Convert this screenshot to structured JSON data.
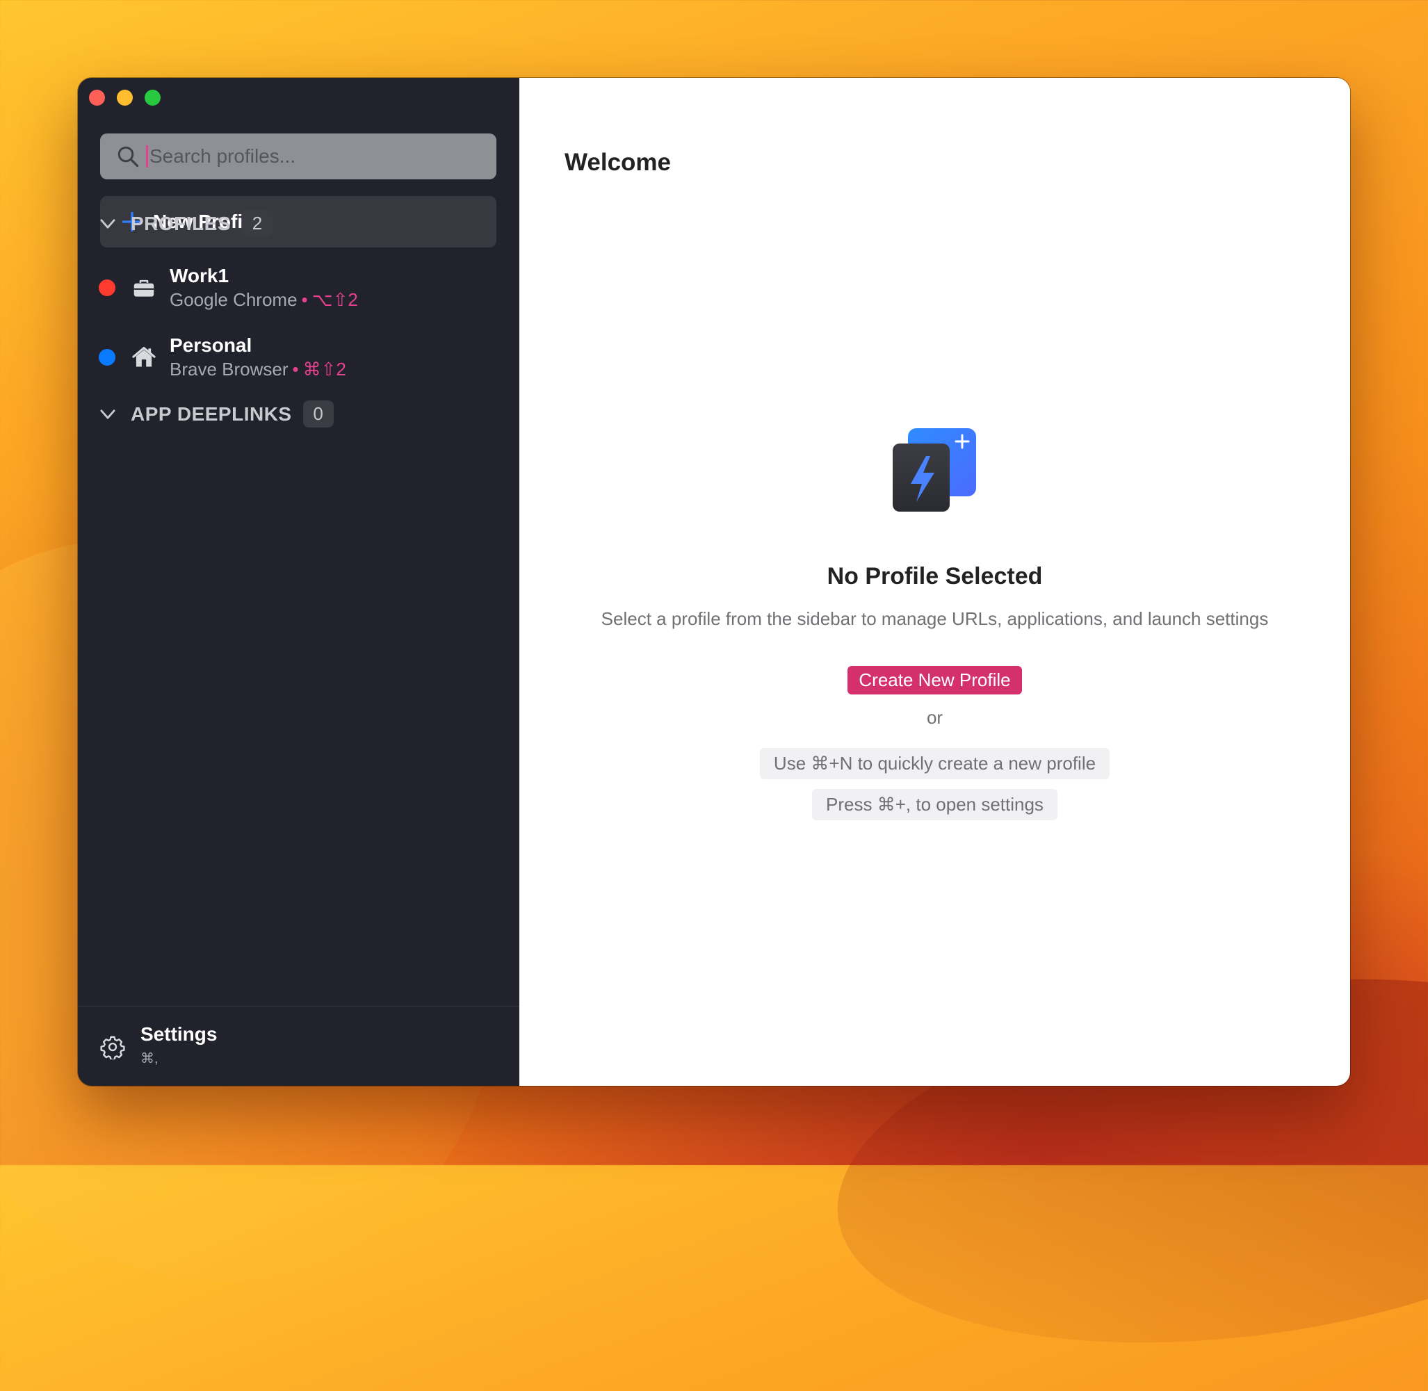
{
  "colors": {
    "sidebar_bg": "#21222b",
    "accent_pink": "#d4306c",
    "work1_dot": "#ff3b30",
    "personal_dot": "#0a7aff"
  },
  "window": {
    "traffic_lights": [
      "close",
      "minimize",
      "zoom"
    ]
  },
  "sidebar": {
    "search": {
      "placeholder": "Search profiles...",
      "value": ""
    },
    "new_profile_label": "New Profile",
    "sections": {
      "profiles": {
        "title": "PROFILES",
        "count": "2"
      },
      "deeplinks": {
        "title": "APP DEEPLINKS",
        "count": "0"
      }
    },
    "profiles": [
      {
        "name": "Work1",
        "browser": "Google Chrome",
        "separator": "•",
        "shortcut": "⌥⇧2",
        "icon": "briefcase-icon",
        "dot_color": "#ff3b30"
      },
      {
        "name": "Personal",
        "browser": "Brave Browser",
        "separator": "•",
        "shortcut": "⌘⇧2",
        "icon": "house-icon",
        "dot_color": "#0a7aff"
      }
    ],
    "settings": {
      "label": "Settings",
      "shortcut": "⌘,"
    }
  },
  "main": {
    "title": "Welcome",
    "empty_state": {
      "heading": "No Profile Selected",
      "description": "Select a profile from the sidebar to manage URLs, applications, and launch settings",
      "create_button": "Create New Profile",
      "or": "or",
      "hint_new": "Use ⌘+N to quickly create a new profile",
      "hint_settings": "Press ⌘+, to open settings"
    }
  }
}
